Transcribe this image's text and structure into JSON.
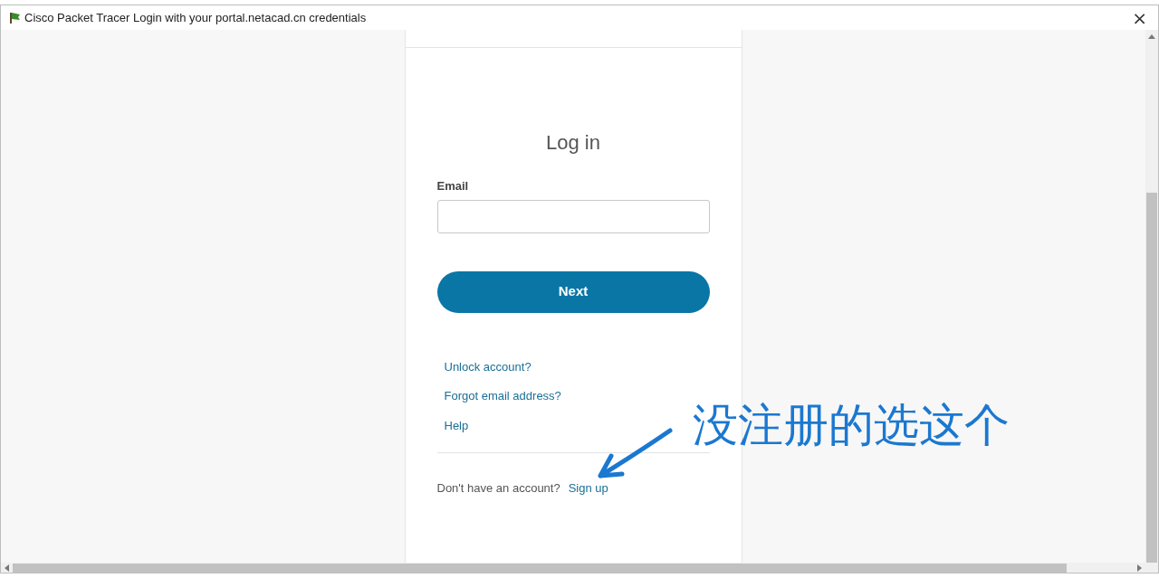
{
  "window": {
    "title": "Cisco Packet Tracer Login with your portal.netacad.cn credentials",
    "close": "×"
  },
  "login": {
    "heading": "Log in",
    "email_label": "Email",
    "next_button": "Next",
    "links": [
      "Unlock account?",
      "Forgot email address?",
      "Help"
    ],
    "footer_text": "Don't have an account?",
    "signup_link": "Sign up"
  },
  "annotation": {
    "text": "没注册的选这个"
  }
}
